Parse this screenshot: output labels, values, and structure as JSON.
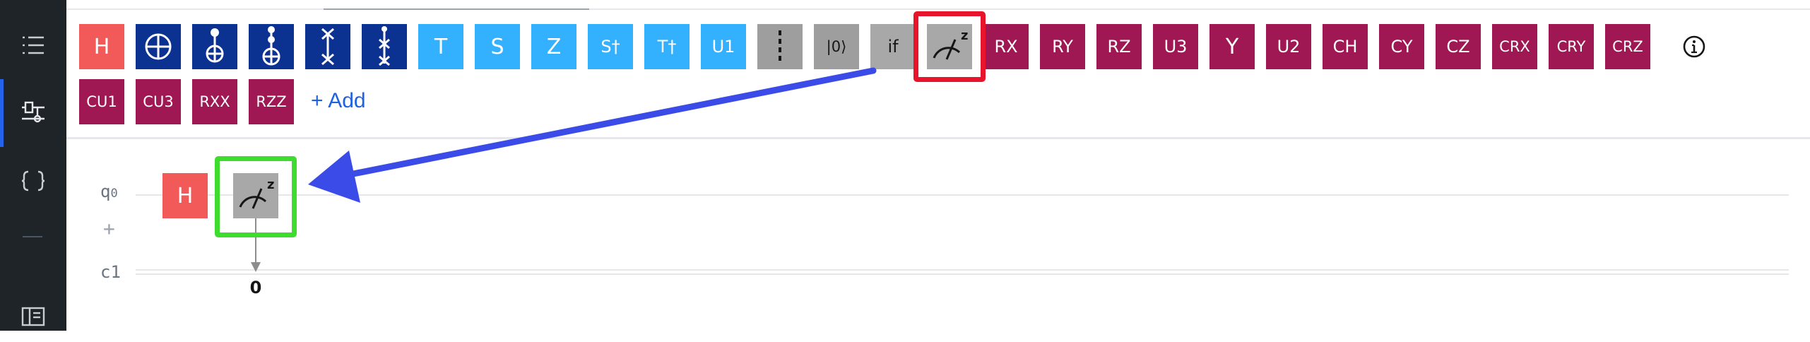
{
  "sidebar": {
    "items": [
      {
        "name": "list-icon"
      },
      {
        "name": "circuit-composer-icon"
      },
      {
        "name": "code-braces-icon"
      },
      {
        "name": "panel-icon"
      }
    ]
  },
  "palette": {
    "gates_row1": [
      {
        "label": "H",
        "kind": "text",
        "color": "red"
      },
      {
        "label": "",
        "kind": "cnot-target",
        "color": "navy",
        "icon": "plus-circle-icon"
      },
      {
        "label": "",
        "kind": "cnot",
        "color": "navy",
        "icon": "cnot-icon"
      },
      {
        "label": "",
        "kind": "toffoli",
        "color": "navy",
        "icon": "toffoli-icon"
      },
      {
        "label": "",
        "kind": "swap",
        "color": "navy",
        "icon": "swap-icon"
      },
      {
        "label": "",
        "kind": "cswap",
        "color": "navy",
        "icon": "controlled-swap-icon"
      },
      {
        "label": "T",
        "kind": "text",
        "color": "cyan"
      },
      {
        "label": "S",
        "kind": "text",
        "color": "cyan"
      },
      {
        "label": "Z",
        "kind": "text",
        "color": "cyan"
      },
      {
        "label": "S†",
        "kind": "text",
        "color": "cyan"
      },
      {
        "label": "T†",
        "kind": "text",
        "color": "cyan"
      },
      {
        "label": "U1",
        "kind": "text",
        "color": "cyan"
      },
      {
        "label": "",
        "kind": "barrier",
        "color": "gray",
        "icon": "barrier-icon"
      },
      {
        "label": "|0⟩",
        "kind": "text",
        "color": "gray"
      },
      {
        "label": "if",
        "kind": "text",
        "color": "gray"
      },
      {
        "label": "z",
        "kind": "measure",
        "color": "gray",
        "icon": "measure-icon"
      },
      {
        "label": "RX",
        "kind": "text",
        "color": "mag"
      },
      {
        "label": "RY",
        "kind": "text",
        "color": "mag"
      },
      {
        "label": "RZ",
        "kind": "text",
        "color": "mag"
      },
      {
        "label": "U3",
        "kind": "text",
        "color": "mag"
      },
      {
        "label": "Y",
        "kind": "text",
        "color": "mag"
      },
      {
        "label": "U2",
        "kind": "text",
        "color": "mag"
      },
      {
        "label": "CH",
        "kind": "text",
        "color": "mag"
      },
      {
        "label": "CY",
        "kind": "text",
        "color": "mag"
      },
      {
        "label": "CZ",
        "kind": "text",
        "color": "mag"
      },
      {
        "label": "CRX",
        "kind": "text",
        "color": "mag"
      },
      {
        "label": "CRY",
        "kind": "text",
        "color": "mag"
      },
      {
        "label": "CRZ",
        "kind": "text",
        "color": "mag"
      }
    ],
    "gates_row2": [
      {
        "label": "CU1"
      },
      {
        "label": "CU3"
      },
      {
        "label": "RXX"
      },
      {
        "label": "RZZ"
      }
    ],
    "add_label": "+ Add"
  },
  "circuit": {
    "qubit_label": "q",
    "qubit_index": "0",
    "add_wire_label": "+",
    "classical_label": "c1",
    "placed_gate": "H",
    "measure_label": "z",
    "measure_target_bit": "0"
  },
  "colors": {
    "red": "#f25a5a",
    "navy": "#0b3191",
    "cyan": "#33b1ff",
    "gray": "#9e9e9e",
    "mag": "#9f1853",
    "annotation_red": "#e8142b",
    "annotation_green": "#3ddc2f",
    "annotation_arrow": "#3a4be8",
    "link": "#1f62e0"
  }
}
